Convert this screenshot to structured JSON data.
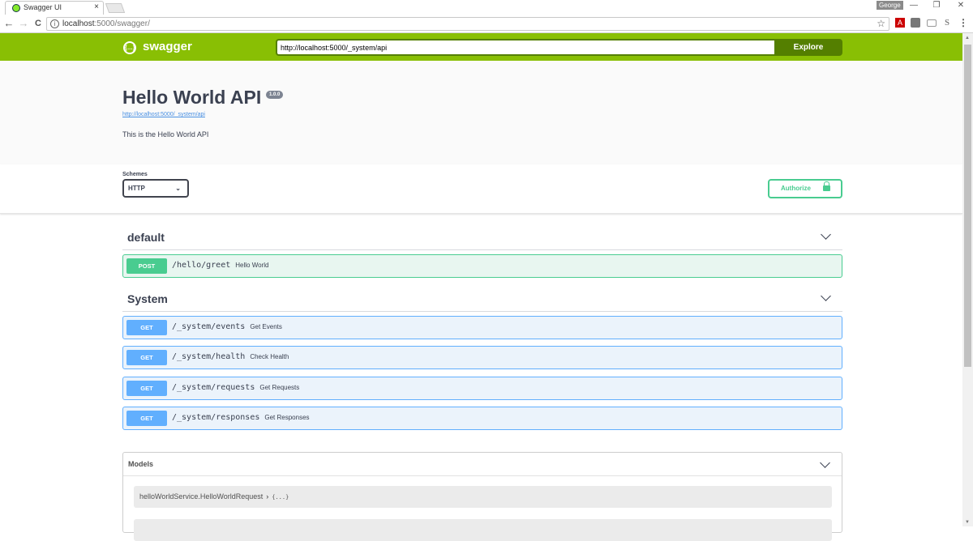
{
  "browser": {
    "tab_title": "Swagger UI",
    "tab_close": "×",
    "profile_name": "George",
    "address_host": "localhost",
    "address_rest": ":5000/swagger/",
    "minimize": "—",
    "restore": "❐",
    "close": "✕",
    "back": "←",
    "forward": "→",
    "reload": "C",
    "star": "☆",
    "menu": "⋮"
  },
  "topbar": {
    "logo_text": "swagger",
    "logo_glyph": "{…}",
    "explore_value": "http://localhost:5000/_system/api",
    "explore_label": "Explore",
    "color": "#89bf04"
  },
  "info": {
    "title": "Hello World API",
    "version": "1.0.0",
    "url": "http://localhost:5000/_system/api",
    "description": "This is the Hello World API"
  },
  "schemes": {
    "label": "Schemes",
    "selected": "HTTP",
    "authorize_label": "Authorize"
  },
  "groups": [
    {
      "name": "default",
      "operations": [
        {
          "method": "POST",
          "path": "/hello/greet",
          "summary": "Hello World"
        }
      ]
    },
    {
      "name": "System",
      "operations": [
        {
          "method": "GET",
          "path": "/_system/events",
          "summary": "Get Events"
        },
        {
          "method": "GET",
          "path": "/_system/health",
          "summary": "Check Health"
        },
        {
          "method": "GET",
          "path": "/_system/requests",
          "summary": "Get Requests"
        },
        {
          "method": "GET",
          "path": "/_system/responses",
          "summary": "Get Responses"
        }
      ]
    }
  ],
  "models": {
    "title": "Models",
    "items": [
      {
        "name": "helloWorldService.HelloWorldRequest",
        "caret": "›",
        "brace": "{...}"
      }
    ]
  },
  "colors": {
    "post": "#49cc90",
    "get": "#61affe",
    "text": "#3b4151"
  }
}
